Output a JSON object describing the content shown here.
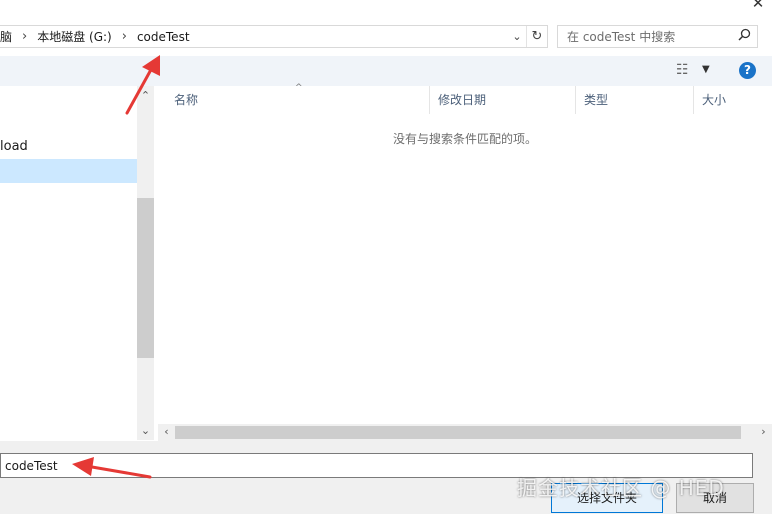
{
  "window": {
    "close_glyph": "✕"
  },
  "address": {
    "crumbs": [
      "脑",
      "本地磁盘 (G:)",
      "codeTest"
    ],
    "separator": "›",
    "dropdown_glyph": "⌄",
    "refresh_glyph": "↻"
  },
  "search": {
    "placeholder": "在 codeTest 中搜索",
    "icon": "search-icon"
  },
  "toolbar": {
    "view_glyph": "☷",
    "dropdown_glyph": "▼",
    "help_label": "?"
  },
  "nav": {
    "items": [
      {
        "label": "load"
      }
    ],
    "scroll_up": "⌃",
    "scroll_down": "⌄"
  },
  "content": {
    "columns": [
      "名称",
      "修改日期",
      "类型",
      "大小"
    ],
    "sort_glyph": "^",
    "empty_message": "没有与搜索条件匹配的项。"
  },
  "hscroll": {
    "left_glyph": "‹",
    "right_glyph": "›"
  },
  "bottom": {
    "folder_value": "codeTest",
    "select_button": "选择文件夹",
    "cancel_button": "取消"
  },
  "watermark": "掘金技术社区 @ HED",
  "colors": {
    "accent": "#0078d7",
    "selection": "#cce8ff",
    "help": "#1a73c8",
    "annotation": "#e53935"
  }
}
